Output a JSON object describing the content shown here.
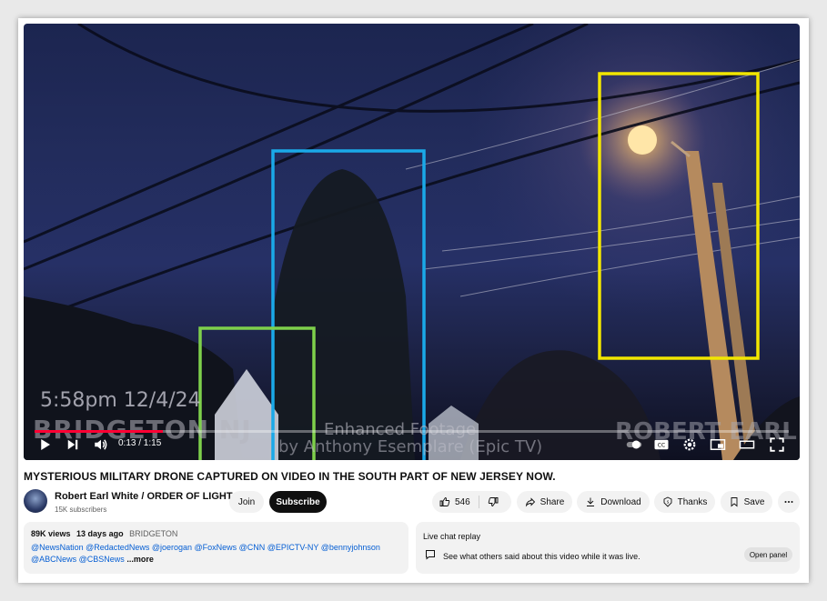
{
  "video": {
    "overlay_timestamp": "5:58pm 12/4/24",
    "overlay_location": "BRIDGETON NJ",
    "overlay_enhanced": "Enhanced Footage",
    "overlay_by": "by Anthony Esemplare (Epic TV)",
    "overlay_watermark": "ROBERT EARL WHITE",
    "time_display": "0:13 / 1:15",
    "progress_fraction": 0.17,
    "annotation_colors": {
      "yellow": "#f2e600",
      "blue": "#1aa9e8",
      "green": "#7ed04b"
    }
  },
  "title": "MYSTERIOUS MILITARY DRONE CAPTURED ON VIDEO IN THE SOUTH PART OF NEW JERSEY NOW.",
  "channel": {
    "name": "Robert Earl White / ORDER OF LIGHT",
    "subscribers": "15K subscribers",
    "join_label": "Join",
    "subscribe_label": "Subscribe"
  },
  "actions": {
    "like_count": "546",
    "share_label": "Share",
    "download_label": "Download",
    "thanks_label": "Thanks",
    "save_label": "Save"
  },
  "description": {
    "views": "89K views",
    "age": "13 days ago",
    "location_tag": "BRIDGETON",
    "tags_line": "@NewsNation @RedactedNews @joerogan @FoxNews @CNN @EPICTV-NY @bennyjohnson @ABCNews @CBSNews",
    "more_label": "...more"
  },
  "chat": {
    "title": "Live chat replay",
    "description": "See what others said about this video while it was live.",
    "open_panel_label": "Open panel"
  },
  "colors": {
    "subscribe_bg": "#0f0f0f",
    "link": "#065fd4",
    "progress": "#ff0033"
  }
}
